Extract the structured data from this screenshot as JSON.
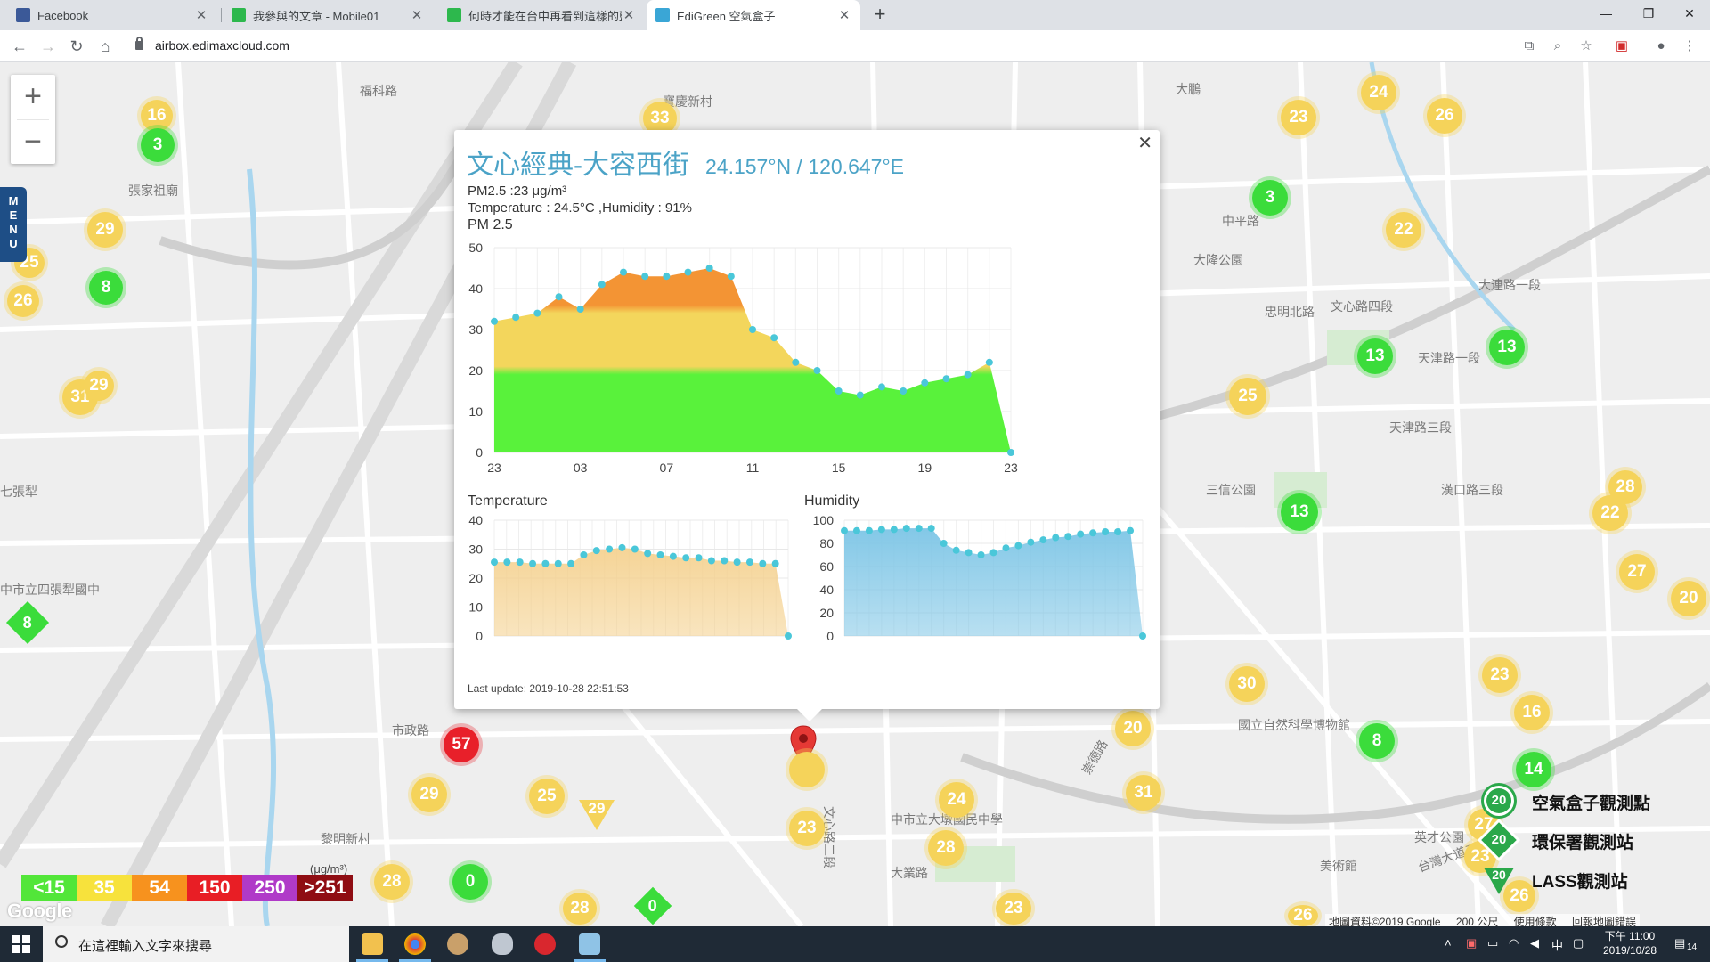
{
  "browser": {
    "tabs": [
      {
        "title": "Facebook",
        "icon_color": "#3b5998",
        "active": false
      },
      {
        "title": "我參與的文章 - Mobile01",
        "icon_color": "#2db84d",
        "active": false
      },
      {
        "title": "何時才能在台中再看到這樣的藍天",
        "icon_color": "#2db84d",
        "active": false
      },
      {
        "title": "EdiGreen 空氣盒子",
        "icon_color": "#3aa6d6",
        "active": true
      }
    ],
    "url": "airbox.edimaxcloud.com"
  },
  "map": {
    "menu_label": "MENU",
    "attribution": [
      "地圖資料©2019 Google",
      "200 公尺",
      "使用條款",
      "回報地圖錯誤"
    ],
    "google_logo": "Google",
    "road_labels": [
      "福科路",
      "寶慶新村",
      "大鵬",
      "中平路",
      "大隆公園",
      "文心路四段",
      "七張犁",
      "張家祖廟",
      "中市立四張犁國中",
      "天津路一段",
      "大連路一段",
      "天津路三段",
      "漢口路三段",
      "三信公園",
      "國立自然科學博物館",
      "大業路",
      "黎明新村",
      "市政路",
      "文心路二段",
      "台灣大道二段",
      "英才公園",
      "美術館",
      "中市立大墩國民中學",
      "崇德路",
      "忠明北路"
    ],
    "markers": [
      {
        "label": "16",
        "color": "yellow"
      },
      {
        "label": "3",
        "color": "green"
      },
      {
        "label": "29",
        "color": "yellow"
      },
      {
        "label": "8",
        "color": "green"
      },
      {
        "label": "26",
        "color": "yellow"
      },
      {
        "label": "25",
        "color": "yellow"
      },
      {
        "label": "31",
        "color": "yellow"
      },
      {
        "label": "29",
        "color": "yellow"
      },
      {
        "label": "33",
        "color": "yellow"
      },
      {
        "label": "23",
        "color": "yellow"
      },
      {
        "label": "24",
        "color": "yellow"
      },
      {
        "label": "26",
        "color": "yellow"
      },
      {
        "label": "3",
        "color": "green"
      },
      {
        "label": "22",
        "color": "yellow"
      },
      {
        "label": "13",
        "color": "green"
      },
      {
        "label": "13",
        "color": "green"
      },
      {
        "label": "25",
        "color": "yellow"
      },
      {
        "label": "13",
        "color": "green"
      },
      {
        "label": "28",
        "color": "yellow"
      },
      {
        "label": "22",
        "color": "yellow"
      },
      {
        "label": "27",
        "color": "yellow"
      },
      {
        "label": "20",
        "color": "yellow"
      },
      {
        "label": "30",
        "color": "yellow"
      },
      {
        "label": "23",
        "color": "yellow"
      },
      {
        "label": "16",
        "color": "yellow"
      },
      {
        "label": "8",
        "color": "green"
      },
      {
        "label": "14",
        "color": "green"
      },
      {
        "label": "20",
        "color": "yellow"
      },
      {
        "label": "31",
        "color": "yellow"
      },
      {
        "label": "24",
        "color": "yellow"
      },
      {
        "label": "28",
        "color": "yellow"
      },
      {
        "label": "23",
        "color": "yellow"
      },
      {
        "label": "57",
        "color": "red"
      },
      {
        "label": "29",
        "color": "yellow"
      },
      {
        "label": "25",
        "color": "yellow"
      },
      {
        "label": "28",
        "color": "yellow"
      },
      {
        "label": "0",
        "color": "green"
      },
      {
        "label": "28",
        "color": "yellow"
      },
      {
        "label": "23",
        "color": "yellow"
      },
      {
        "label": "27",
        "color": "yellow"
      },
      {
        "label": "23",
        "color": "yellow"
      },
      {
        "label": "26",
        "color": "yellow"
      },
      {
        "label": "26",
        "color": "yellow"
      }
    ],
    "diamonds": [
      {
        "label": "8",
        "color": "#3bdc3b"
      },
      {
        "label": "0",
        "color": "#3bdc3b"
      }
    ],
    "triangles": [
      {
        "label": "29",
        "color": "#f5d35a"
      }
    ]
  },
  "pm_legend": {
    "unit": "(μg/m³)",
    "cells": [
      {
        "label": "<15",
        "color": "#52e639"
      },
      {
        "label": "35",
        "color": "#f7e23c"
      },
      {
        "label": "54",
        "color": "#f7921e"
      },
      {
        "label": "150",
        "color": "#e81e25"
      },
      {
        "label": "250",
        "color": "#b03ac8"
      },
      {
        "label": ">251",
        "color": "#8f0d13"
      }
    ]
  },
  "station_legend": [
    {
      "label": "空氣盒子觀測點",
      "value": "20",
      "shape": "circle"
    },
    {
      "label": "環保署觀測站",
      "value": "20",
      "shape": "diamond"
    },
    {
      "label": "LASS觀測站",
      "value": "20",
      "shape": "triangle"
    }
  ],
  "popup": {
    "title": "文心經典-大容西街",
    "coords": "24.157°N / 120.647°E",
    "pm25_line": "PM2.5 :23 μg/m³",
    "temp_hum_line": "Temperature : 24.5°C ,Humidity : 91%",
    "pm_chart_title": "PM 2.5",
    "temp_chart_title": "Temperature",
    "hum_chart_title": "Humidity",
    "last_update": "Last update: 2019-10-28 22:51:53"
  },
  "chart_data": [
    {
      "type": "area",
      "title": "PM 2.5",
      "x_tick_labels": [
        "23",
        "03",
        "07",
        "11",
        "15",
        "19",
        "23"
      ],
      "y_ticks": [
        0,
        10,
        20,
        30,
        40,
        50
      ],
      "ylim": [
        0,
        50
      ],
      "color_bands": [
        {
          "max": 20,
          "color": "#59f23b"
        },
        {
          "max": 35,
          "color": "#f3d65c"
        },
        {
          "max": 50,
          "color": "#f39434"
        }
      ],
      "values": [
        32,
        33,
        34,
        38,
        35,
        41,
        44,
        43,
        43,
        44,
        45,
        43,
        30,
        28,
        22,
        20,
        15,
        14,
        16,
        15,
        17,
        18,
        19,
        22,
        0
      ]
    },
    {
      "type": "area",
      "title": "Temperature",
      "y_ticks": [
        0,
        10,
        20,
        30,
        40
      ],
      "ylim": [
        0,
        40
      ],
      "color": "#f4cf8a",
      "values": [
        25.5,
        25.5,
        25.5,
        25,
        25,
        25,
        25,
        28,
        29.5,
        30,
        30.5,
        30,
        28.5,
        28,
        27.5,
        27,
        27,
        26,
        26,
        25.5,
        25.5,
        25,
        25,
        0
      ]
    },
    {
      "type": "area",
      "title": "Humidity",
      "y_ticks": [
        0,
        20,
        40,
        60,
        80,
        100
      ],
      "ylim": [
        0,
        100
      ],
      "color": "#7fc6e6",
      "values": [
        91,
        91,
        91,
        92,
        92,
        93,
        93,
        93,
        80,
        74,
        72,
        70,
        72,
        76,
        78,
        81,
        83,
        85,
        86,
        88,
        89,
        90,
        90,
        91,
        0
      ]
    }
  ],
  "taskbar": {
    "search_placeholder": "在這裡輸入文字來搜尋",
    "time": "下午 11:00",
    "date": "2019/10/28",
    "notification_count": "14",
    "ime": "中"
  }
}
